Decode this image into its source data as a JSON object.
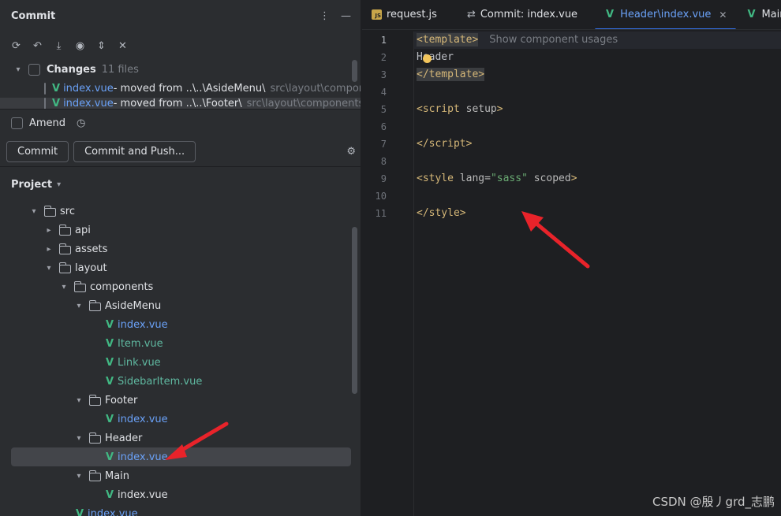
{
  "commit_panel": {
    "title": "Commit",
    "changes_label": "Changes",
    "changes_count": "11 files",
    "change_items": [
      {
        "file": "index.vue",
        "desc": " - moved from ..\\..\\AsideMenu\\",
        "path": "src\\layout\\compone"
      },
      {
        "file": "index.vue",
        "desc": " - moved from ..\\..\\Footer\\",
        "path": "src\\layout\\components\\F"
      }
    ],
    "amend_label": "Amend",
    "commit_button": "Commit",
    "commit_push_button": "Commit and Push..."
  },
  "project": {
    "title": "Project",
    "tree": [
      {
        "label": "src",
        "type": "folder",
        "level": 1,
        "open": true
      },
      {
        "label": "api",
        "type": "folder",
        "level": 2,
        "open": false
      },
      {
        "label": "assets",
        "type": "folder",
        "level": 2,
        "open": false
      },
      {
        "label": "layout",
        "type": "folder",
        "level": 2,
        "open": true
      },
      {
        "label": "components",
        "type": "folder",
        "level": 3,
        "open": true
      },
      {
        "label": "AsideMenu",
        "type": "folder",
        "level": 4,
        "open": true
      },
      {
        "label": "index.vue",
        "type": "vue",
        "level": 5,
        "color": "blue"
      },
      {
        "label": "Item.vue",
        "type": "vue",
        "level": 5,
        "color": "green"
      },
      {
        "label": "Link.vue",
        "type": "vue",
        "level": 5,
        "color": "green"
      },
      {
        "label": "SidebarItem.vue",
        "type": "vue",
        "level": 5,
        "color": "green"
      },
      {
        "label": "Footer",
        "type": "folder",
        "level": 4,
        "open": true
      },
      {
        "label": "index.vue",
        "type": "vue",
        "level": 5,
        "color": "blue"
      },
      {
        "label": "Header",
        "type": "folder",
        "level": 4,
        "open": true
      },
      {
        "label": "index.vue",
        "type": "vue",
        "level": 5,
        "color": "blue",
        "selected": true
      },
      {
        "label": "Main",
        "type": "folder",
        "level": 4,
        "open": true
      },
      {
        "label": "index.vue",
        "type": "vue",
        "level": 5,
        "color": "plain"
      },
      {
        "label": "index.vue",
        "type": "vue",
        "level": 3,
        "color": "blue"
      }
    ]
  },
  "tabs": [
    {
      "label": "request.js",
      "icon": "js-icon"
    },
    {
      "label": "Commit: index.vue",
      "icon": "diff-icon"
    },
    {
      "label": "Header\\index.vue",
      "icon": "vue-icon",
      "active": true,
      "closable": true
    },
    {
      "label": "Main\\in",
      "icon": "vue-icon"
    }
  ],
  "editor": {
    "hint": "Show component usages",
    "lines": [
      "1",
      "2",
      "3",
      "4",
      "5",
      "6",
      "7",
      "8",
      "9",
      "10",
      "11"
    ]
  },
  "watermark": "CSDN @殷丿grd_志鹏",
  "colors": {
    "accent": "#3574f0",
    "vue_green": "#41b883",
    "arrow_red": "#e8232a"
  }
}
